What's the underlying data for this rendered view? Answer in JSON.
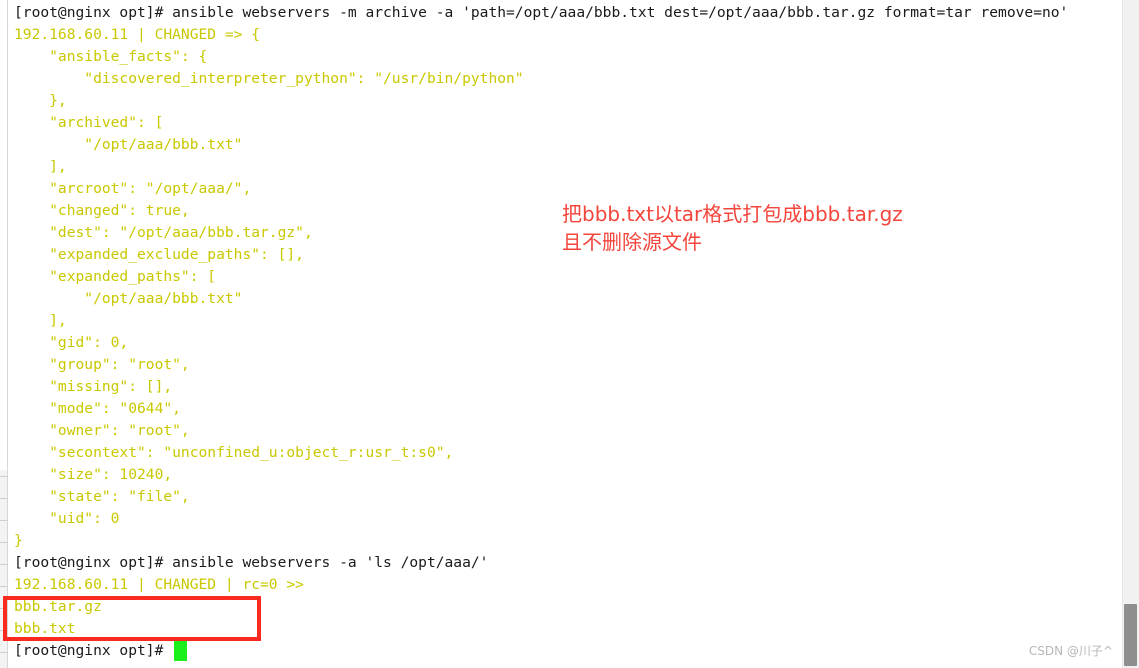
{
  "terminal": {
    "prompt": "[root@nginx opt]# ",
    "lines": [
      {
        "kind": "command",
        "text": "[root@nginx opt]# ansible webservers -m archive -a 'path=/opt/aaa/bbb.txt dest=/opt/aaa/bbb.tar.gz format=tar remove=no'"
      },
      {
        "kind": "output",
        "text": "192.168.60.11 | CHANGED => {"
      },
      {
        "kind": "output",
        "text": "    \"ansible_facts\": {"
      },
      {
        "kind": "output",
        "text": "        \"discovered_interpreter_python\": \"/usr/bin/python\""
      },
      {
        "kind": "output",
        "text": "    },"
      },
      {
        "kind": "output",
        "text": "    \"archived\": ["
      },
      {
        "kind": "output",
        "text": "        \"/opt/aaa/bbb.txt\""
      },
      {
        "kind": "output",
        "text": "    ],"
      },
      {
        "kind": "output",
        "text": "    \"arcroot\": \"/opt/aaa/\","
      },
      {
        "kind": "output",
        "text": "    \"changed\": true,"
      },
      {
        "kind": "output",
        "text": "    \"dest\": \"/opt/aaa/bbb.tar.gz\","
      },
      {
        "kind": "output",
        "text": "    \"expanded_exclude_paths\": [],"
      },
      {
        "kind": "output",
        "text": "    \"expanded_paths\": ["
      },
      {
        "kind": "output",
        "text": "        \"/opt/aaa/bbb.txt\""
      },
      {
        "kind": "output",
        "text": "    ],"
      },
      {
        "kind": "output",
        "text": "    \"gid\": 0,"
      },
      {
        "kind": "output",
        "text": "    \"group\": \"root\","
      },
      {
        "kind": "output",
        "text": "    \"missing\": [],"
      },
      {
        "kind": "output",
        "text": "    \"mode\": \"0644\","
      },
      {
        "kind": "output",
        "text": "    \"owner\": \"root\","
      },
      {
        "kind": "output",
        "text": "    \"secontext\": \"unconfined_u:object_r:usr_t:s0\","
      },
      {
        "kind": "output",
        "text": "    \"size\": 10240,"
      },
      {
        "kind": "output",
        "text": "    \"state\": \"file\","
      },
      {
        "kind": "output",
        "text": "    \"uid\": 0"
      },
      {
        "kind": "output",
        "text": "}"
      },
      {
        "kind": "command",
        "text": "[root@nginx opt]# ansible webservers -a 'ls /opt/aaa/'"
      },
      {
        "kind": "output",
        "text": "192.168.60.11 | CHANGED | rc=0 >>"
      },
      {
        "kind": "output",
        "text": "bbb.tar.gz"
      },
      {
        "kind": "output",
        "text": "bbb.txt"
      },
      {
        "kind": "command",
        "text": "[root@nginx opt]# "
      }
    ],
    "colors": {
      "command": "#1a1a1a",
      "output": "#c9c800",
      "background": "#ffffff",
      "cursor": "#1cf01c"
    }
  },
  "annotation": {
    "line1": "把bbb.txt以tar格式打包成bbb.tar.gz",
    "line2": "且不删除源文件",
    "color": "#f4453c"
  },
  "highlight": {
    "label": "ls-result-highlight",
    "color": "#fa2a20"
  },
  "scrollbar": {
    "track_color": "#f1f1f1",
    "thumb_color": "#8e8e8e"
  },
  "watermark": {
    "text": "CSDN @川子^"
  }
}
